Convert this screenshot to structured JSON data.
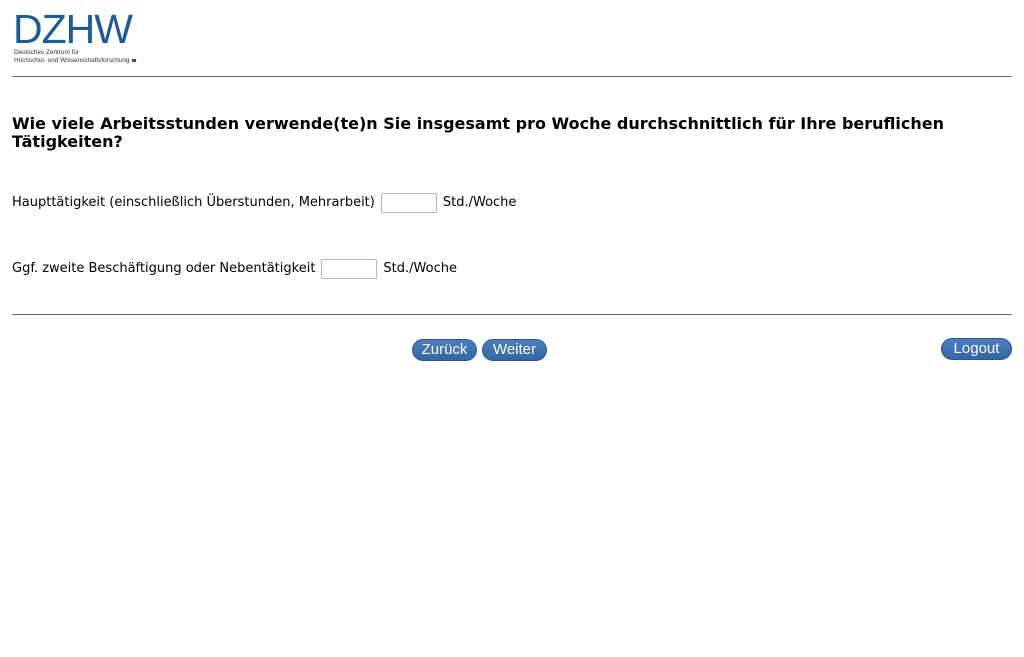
{
  "logo": {
    "mark": "DZHW",
    "line1": "Deutsches Zentrum für",
    "line2": "Hochschul- und Wissenschaftsforschung"
  },
  "question": "Wie viele Arbeitsstunden verwende(te)n Sie insgesamt pro Woche durchschnittlich für Ihre beruflichen Tätigkeiten?",
  "fields": [
    {
      "label": "Haupttätigkeit (einschließlich Überstunden, Mehrarbeit)",
      "value": "",
      "unit": "Std./Woche"
    },
    {
      "label": "Ggf. zweite Beschäftigung oder Nebentätigkeit",
      "value": "",
      "unit": "Std./Woche"
    }
  ],
  "nav": {
    "back_label": "Zurück",
    "next_label": "Weiter",
    "logout_label": "Logout"
  },
  "colors": {
    "brand_blue": "#1d5a9a",
    "button_blue": "#3466a6"
  }
}
